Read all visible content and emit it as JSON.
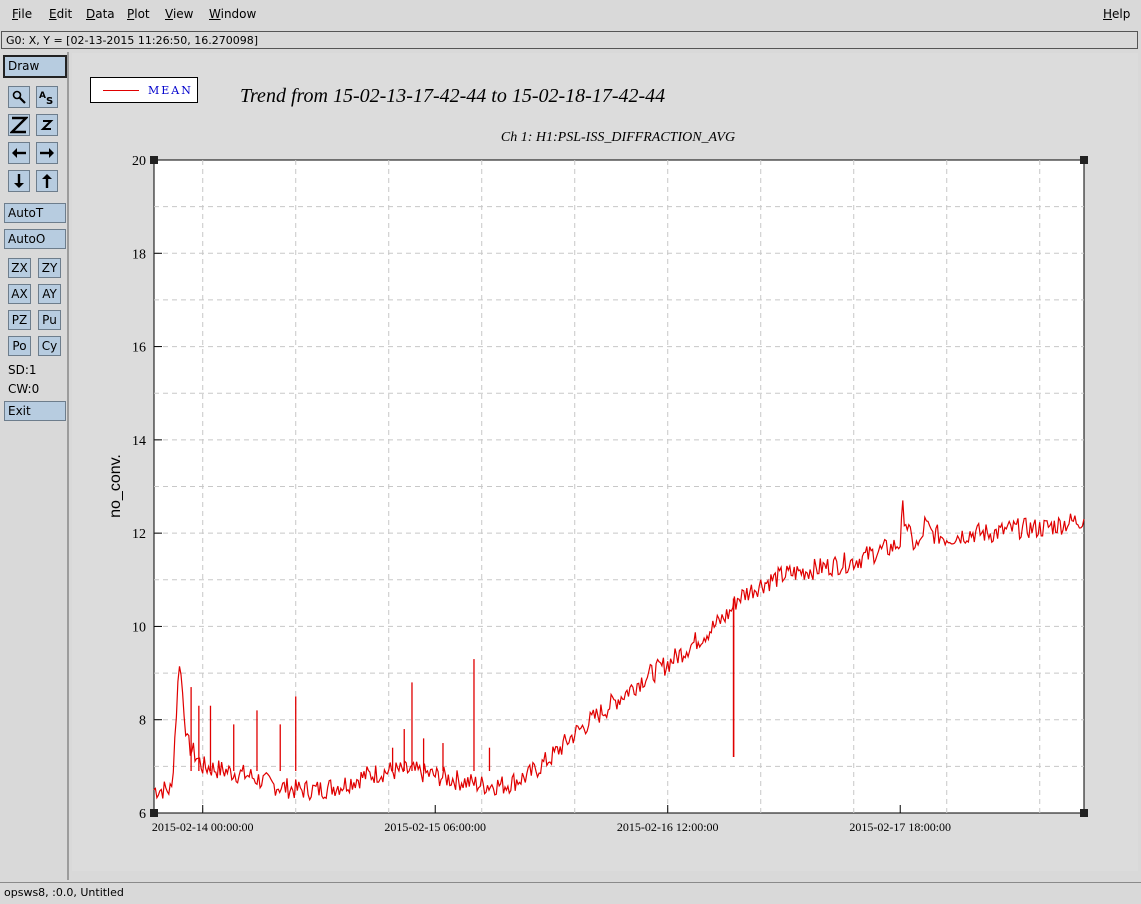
{
  "menu": {
    "file": "File",
    "edit": "Edit",
    "data": "Data",
    "plot": "Plot",
    "view": "View",
    "window": "Window",
    "help": "Help"
  },
  "coord_readout": "G0: X, Y = [02-13-2015 11:26:50, 16.270098]",
  "toolbar": {
    "draw": "Draw",
    "icons": [
      "zoom-pointer-icon",
      "text-size-icon",
      "zoom-z-large-icon",
      "zoom-z-small-icon",
      "arrow-left-icon",
      "arrow-right-icon",
      "arrow-down-icon",
      "arrow-up-icon"
    ],
    "autot": "AutoT",
    "autoo": "AutoO",
    "zx": "ZX",
    "zy": "ZY",
    "ax": "AX",
    "ay": "AY",
    "pz": "PZ",
    "pu": "Pu",
    "po": "Po",
    "cy": "Cy",
    "sd": "SD:1",
    "cw": "CW:0",
    "exit": "Exit"
  },
  "status": "opsws8, :0.0, Untitled",
  "legend": {
    "label": "MEAN",
    "color": "#e00000"
  },
  "plot": {
    "title": "Trend from 15-02-13-17-42-44 to 15-02-18-17-42-44"
  },
  "chart_data": {
    "type": "line",
    "subtitle": "Ch 1: H1:PSL-ISS_DIFFRACTION_AVG",
    "ylabel": "no_conv.",
    "xlabel": "",
    "xlim": [
      "2015-02-13 17:42:44",
      "2015-02-18 17:42:44"
    ],
    "ylim": [
      6,
      20
    ],
    "yticks": [
      "6",
      "8",
      "10",
      "12",
      "14",
      "16",
      "18",
      "20"
    ],
    "xticks": [
      "2015-02-14 00:00:00",
      "2015-02-15 06:00:00",
      "2015-02-16 12:00:00",
      "2015-02-17 18:00:00"
    ],
    "grid": true,
    "series": [
      {
        "name": "MEAN",
        "color": "#e00000",
        "x": [
          "2015-02-13 17:42",
          "2015-02-13 20:00",
          "2015-02-13 21:00",
          "2015-02-13 22:00",
          "2015-02-14 00:00",
          "2015-02-14 03:00",
          "2015-02-14 06:00",
          "2015-02-14 09:00",
          "2015-02-14 12:00",
          "2015-02-14 15:00",
          "2015-02-14 18:00",
          "2015-02-14 21:00",
          "2015-02-15 00:00",
          "2015-02-15 03:00",
          "2015-02-15 06:00",
          "2015-02-15 09:00",
          "2015-02-15 12:00",
          "2015-02-15 15:00",
          "2015-02-15 18:00",
          "2015-02-15 21:00",
          "2015-02-16 00:00",
          "2015-02-16 03:00",
          "2015-02-16 06:00",
          "2015-02-16 09:00",
          "2015-02-16 12:00",
          "2015-02-16 15:00",
          "2015-02-16 18:00",
          "2015-02-16 20:00",
          "2015-02-16 21:00",
          "2015-02-16 22:00",
          "2015-02-17 00:00",
          "2015-02-17 03:00",
          "2015-02-17 06:00",
          "2015-02-17 09:00",
          "2015-02-17 12:00",
          "2015-02-17 15:00",
          "2015-02-17 17:00",
          "2015-02-17 18:00",
          "2015-02-17 18:20",
          "2015-02-17 19:30",
          "2015-02-17 20:30",
          "2015-02-17 21:10",
          "2015-02-17 22:00",
          "2015-02-18 00:00",
          "2015-02-18 03:00",
          "2015-02-18 06:00",
          "2015-02-18 09:00",
          "2015-02-18 12:00",
          "2015-02-18 15:00",
          "2015-02-18 17:42"
        ],
        "values": [
          6.5,
          6.5,
          9.3,
          7.5,
          7.0,
          6.9,
          6.8,
          6.6,
          6.5,
          6.5,
          6.6,
          6.8,
          6.9,
          6.9,
          6.8,
          6.7,
          6.6,
          6.6,
          6.8,
          7.2,
          7.7,
          8.1,
          8.5,
          8.9,
          9.2,
          9.6,
          10.0,
          10.3,
          10.6,
          10.7,
          10.9,
          11.1,
          11.2,
          11.3,
          11.4,
          11.6,
          11.7,
          11.8,
          12.5,
          11.8,
          11.7,
          12.2,
          12.0,
          11.9,
          12.0,
          12.0,
          12.1,
          12.1,
          12.2,
          12.3
        ]
      }
    ],
    "spikes": [
      {
        "x": "2015-02-13 22:30",
        "value": 8.7
      },
      {
        "x": "2015-02-13 23:30",
        "value": 8.3
      },
      {
        "x": "2015-02-14 01:00",
        "value": 8.3
      },
      {
        "x": "2015-02-14 04:00",
        "value": 7.9
      },
      {
        "x": "2015-02-14 07:00",
        "value": 8.2
      },
      {
        "x": "2015-02-14 10:00",
        "value": 7.9
      },
      {
        "x": "2015-02-14 12:00",
        "value": 8.5
      },
      {
        "x": "2015-02-15 00:30",
        "value": 7.4
      },
      {
        "x": "2015-02-15 02:00",
        "value": 7.8
      },
      {
        "x": "2015-02-15 03:00",
        "value": 8.8
      },
      {
        "x": "2015-02-15 04:30",
        "value": 7.6
      },
      {
        "x": "2015-02-15 07:00",
        "value": 7.5
      },
      {
        "x": "2015-02-15 11:00",
        "value": 9.3
      },
      {
        "x": "2015-02-15 13:00",
        "value": 7.4
      }
    ],
    "dips": [
      {
        "x": "2015-02-16 20:30",
        "value": 7.2
      }
    ]
  }
}
